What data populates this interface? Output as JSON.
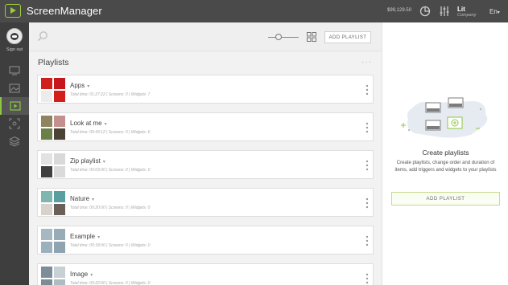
{
  "app": {
    "name": "ScreenManager",
    "balance": "$99,129.50"
  },
  "user": {
    "name": "Lit",
    "role": "Company",
    "sign_out": "Sign out"
  },
  "lang": {
    "label": "En",
    "arrow": "▾"
  },
  "toolbar": {
    "add_playlist_label": "ADD PLAYLIST",
    "search_icon": "search-icon",
    "zoom_level": 0.3
  },
  "main": {
    "title": "Playlists",
    "more": "···"
  },
  "playlists": [
    {
      "name": "Apps",
      "meta": "Total time: 01:27:22  |  Screens: 0  |  Widgets: 7",
      "colors": [
        "#d0201b",
        "#c8161d",
        "#ececec",
        "#d31f1a"
      ]
    },
    {
      "name": "Look at me",
      "meta": "Total time: 00:43:12  |  Screens: 0  |  Widgets: 6",
      "colors": [
        "#8e8560",
        "#c4908d",
        "#6b7f4a",
        "#4b4436"
      ]
    },
    {
      "name": "Zip playlist",
      "meta": "Total time: 00:03:00  |  Screens: 0  |  Widgets: 0",
      "colors": [
        "#e2e2e2",
        "#d9d9d9",
        "#3f3f3f",
        "#dadada"
      ]
    },
    {
      "name": "Nature",
      "meta": "Total time: 00:20:00  |  Screens: 0  |  Widgets: 0",
      "colors": [
        "#7fb6b0",
        "#5b9ea0",
        "#d8d2cb",
        "#6b6058"
      ]
    },
    {
      "name": "Example",
      "meta": "Total time: 00:18:00  |  Screens: 0  |  Widgets: 0",
      "colors": [
        "#a6b9c3",
        "#98acb8",
        "#9cb0bd",
        "#8fa3b0"
      ]
    },
    {
      "name": "Image",
      "meta": "Total time: 00:22:00  |  Screens: 0  |  Widgets: 0",
      "colors": [
        "#7d8e98",
        "#c7d0d4",
        "#7c8c95",
        "#aebcc4"
      ]
    }
  ],
  "right_panel": {
    "title": "Create playlists",
    "description": "Create playlists, change order and duration of items, add triggers and widgets to your playlists",
    "button_label": "ADD PLAYLIST"
  },
  "colors": {
    "topbar": "#4a4a4a",
    "sidebar": "#3e3e3e",
    "accent": "#8dc63f"
  }
}
